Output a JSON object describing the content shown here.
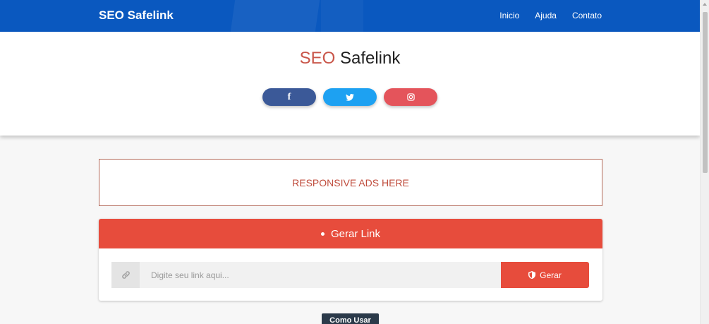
{
  "navbar": {
    "brand": "SEO Safelink",
    "links": [
      "Inicio",
      "Ajuda",
      "Contato"
    ],
    "color": "#0a58bf"
  },
  "hero": {
    "title_accent": "SEO",
    "title_rest": " Safelink",
    "social": [
      {
        "icon": "facebook-icon",
        "glyph": "f",
        "color": "#3b5998"
      },
      {
        "icon": "twitter-icon",
        "glyph": "",
        "color": "#1da1f2"
      },
      {
        "icon": "instagram-icon",
        "glyph": "",
        "color": "#e4545b"
      }
    ]
  },
  "ads": {
    "text": "RESPONSIVE ADS HERE"
  },
  "generator": {
    "header": "Gerar Link",
    "input_placeholder": "Digite seu link aqui...",
    "input_value": "",
    "button_label": "Gerar",
    "accent_color": "#e74c3c"
  },
  "como_usar": {
    "label": "Como Usar"
  }
}
